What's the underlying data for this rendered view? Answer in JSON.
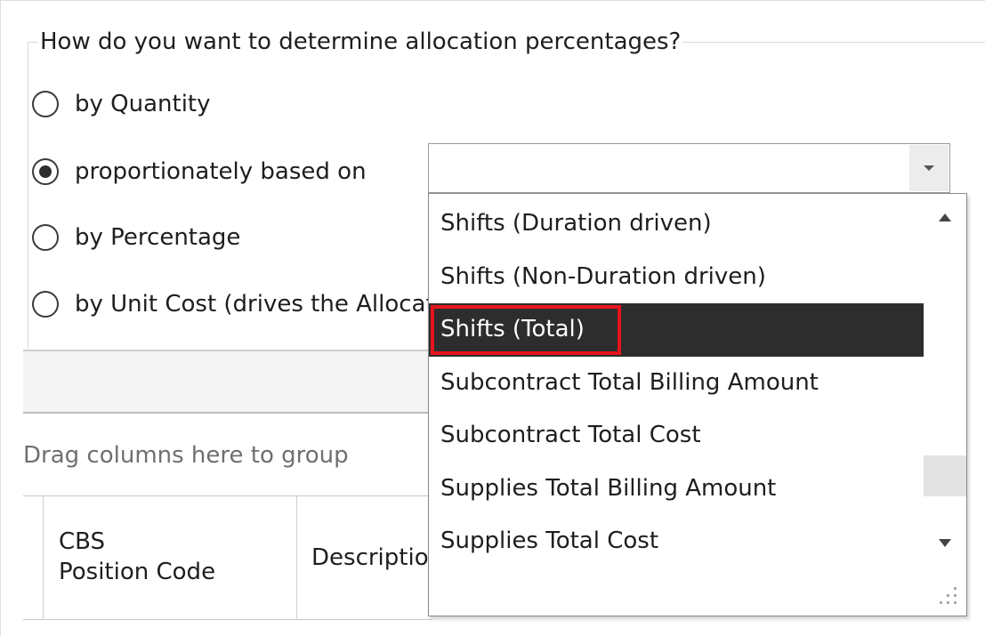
{
  "allocation": {
    "question": "How do you want to determine allocation percentages?",
    "options": [
      {
        "label": "by Quantity",
        "checked": false
      },
      {
        "label": "proportionately based on",
        "checked": true
      },
      {
        "label": "by Percentage",
        "checked": false
      },
      {
        "label": "by Unit Cost (drives the Allocation)",
        "checked": false
      }
    ]
  },
  "combo": {
    "value": "",
    "dropdown_icon": "chevron-down-icon"
  },
  "dropdown": {
    "items": [
      "Shifts (Duration driven)",
      "Shifts (Non-Duration driven)",
      "Shifts (Total)",
      "Subcontract Total Billing Amount",
      "Subcontract Total Cost",
      "Supplies Total Billing Amount",
      "Supplies Total Cost"
    ],
    "selected_index": 2,
    "highlight_color": "#e8141c",
    "selected_bg": "#2d2d2d"
  },
  "grid": {
    "group_hint": "Drag columns here to group",
    "columns": [
      {
        "line1": "CBS",
        "line2": "Position Code"
      },
      {
        "line1": "Description",
        "line2": ""
      }
    ]
  }
}
